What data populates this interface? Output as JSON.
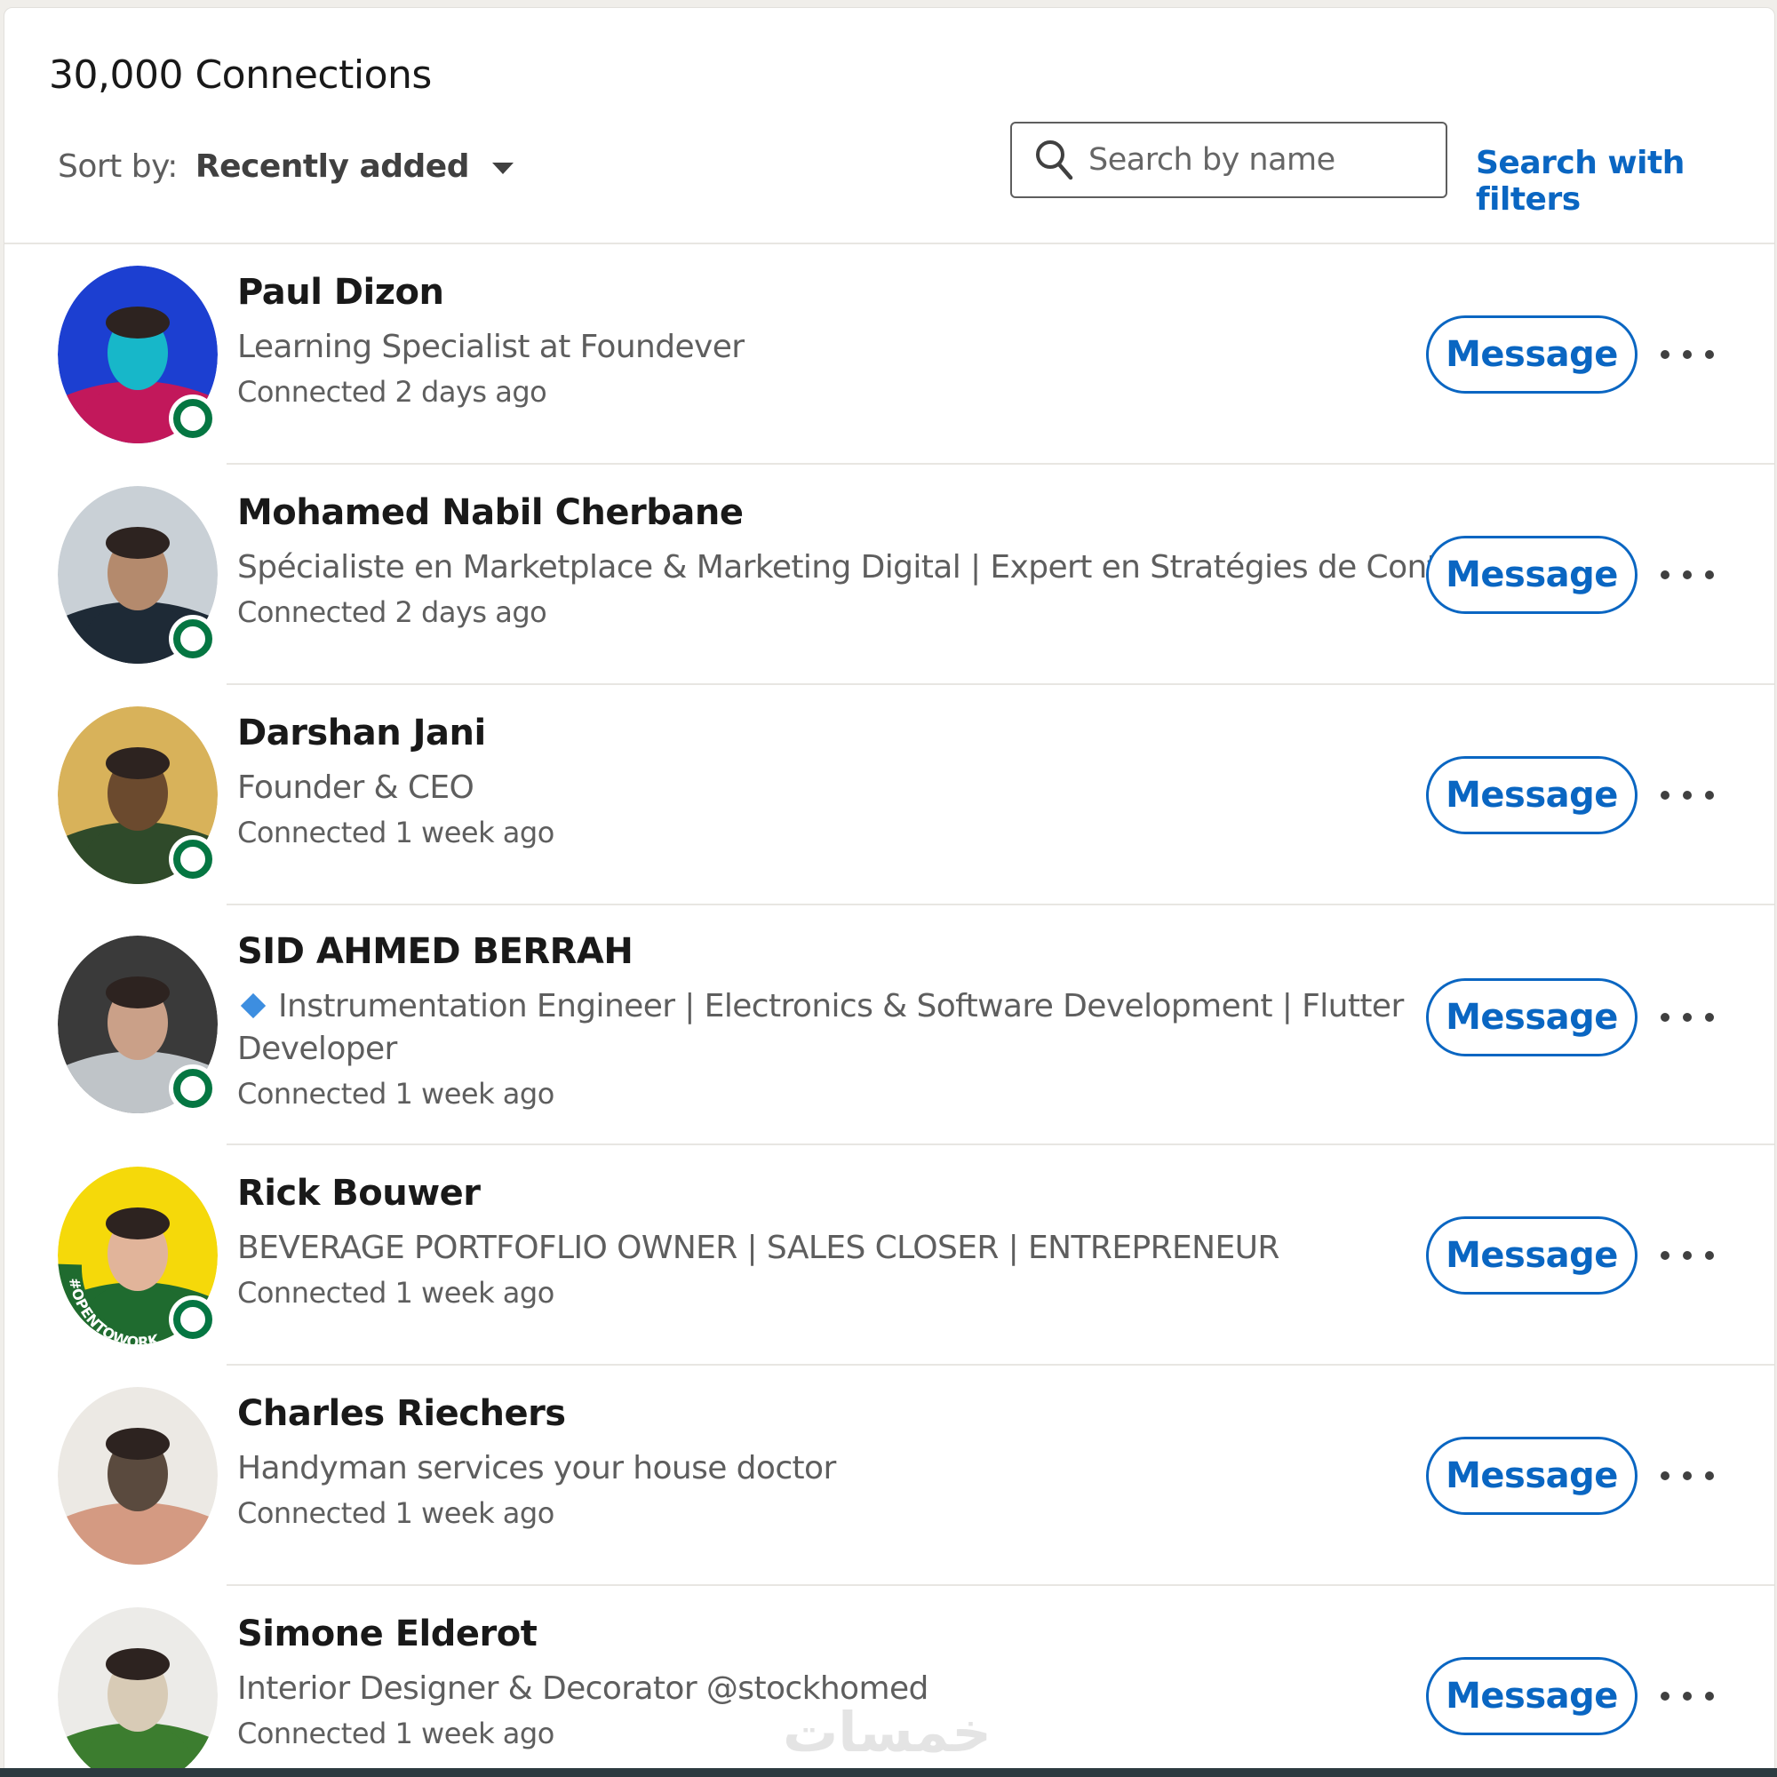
{
  "header": {
    "title": "30,000 Connections",
    "sort_label": "Sort by:",
    "sort_value": "Recently added",
    "search_placeholder": "Search by name",
    "search_value": "",
    "filters_link": "Search with filters"
  },
  "connections": [
    {
      "name": "Paul Dizon",
      "headline": "Learning Specialist at Foundever",
      "connected": "Connected 2 days ago",
      "button": "Message",
      "avatar_colors": [
        "#1c3fd1",
        "#c2185b",
        "#17b7c9"
      ]
    },
    {
      "name": "Mohamed Nabil Cherbane",
      "headline": "Spécialiste en Marketplace & Marketing Digital | Expert en Stratégies de Contenu",
      "connected": "Connected 2 days ago",
      "button": "Message",
      "avatar_colors": [
        "#c9d0d6",
        "#1e2a36",
        "#b48a6d"
      ]
    },
    {
      "name": "Darshan Jani",
      "headline": "Founder & CEO",
      "connected": "Connected 1 week ago",
      "button": "Message",
      "avatar_colors": [
        "#d8b25a",
        "#2f4a2a",
        "#6b4a2e"
      ]
    },
    {
      "name": "SID AHMED BERRAH",
      "headline": "Instrumentation Engineer | Electronics & Software Development | Flutter Developer",
      "connected": "Connected 1 week ago",
      "button": "Message",
      "avatar_colors": [
        "#3a3a3a",
        "#bfc4c8",
        "#caa088"
      ]
    },
    {
      "name": "Rick Bouwer",
      "headline": "BEVERAGE PORTFOFLIO OWNER | SALES CLOSER | ENTREPRENEUR",
      "connected": "Connected 1 week ago",
      "button": "Message",
      "avatar_colors": [
        "#f5d90a",
        "#1f6b2f",
        "#e1b49a"
      ],
      "frame_text": "#OPENTOWORK"
    },
    {
      "name": "Charles Riechers",
      "headline": "Handyman services your house doctor",
      "connected": "Connected 1 week ago",
      "button": "Message",
      "avatar_colors": [
        "#ece9e4",
        "#d49a82",
        "#5a4a3e"
      ]
    },
    {
      "name": "Simone Elderot",
      "headline": "Interior Designer & Decorator @stockhomed",
      "connected": "Connected 1 week ago",
      "button": "Message",
      "avatar_colors": [
        "#ecebe8",
        "#3c7d2f",
        "#d8cbb6"
      ]
    }
  ],
  "watermark": "خمسات",
  "colors": {
    "link": "#0a66c2",
    "presence": "#057642",
    "text_primary": "#191919",
    "text_secondary": "#5e5e5e"
  }
}
